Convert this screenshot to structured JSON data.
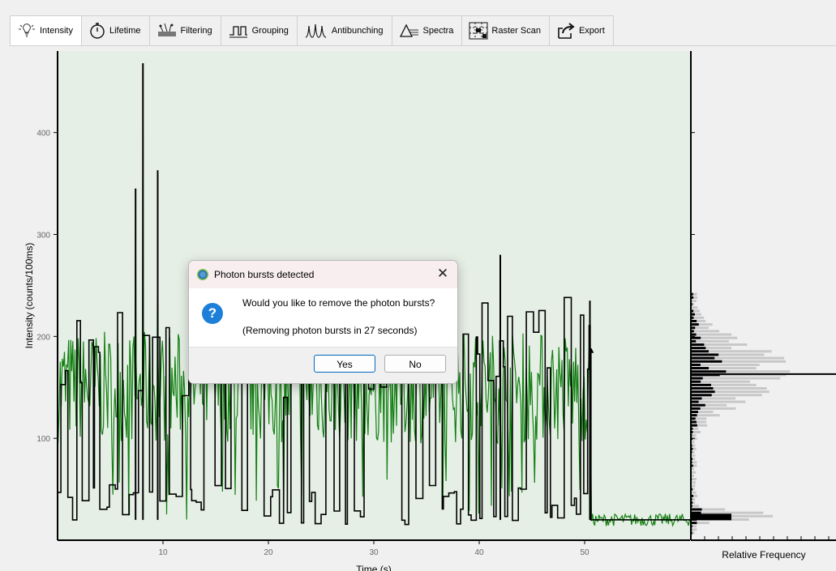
{
  "tabs": [
    {
      "label": "Intensity",
      "icon": "lightbulb-icon",
      "active": true
    },
    {
      "label": "Lifetime",
      "icon": "stopwatch-icon",
      "active": false
    },
    {
      "label": "Filtering",
      "icon": "filter-icon",
      "active": false
    },
    {
      "label": "Grouping",
      "icon": "grouping-icon",
      "active": false
    },
    {
      "label": "Antibunching",
      "icon": "antibunching-icon",
      "active": false
    },
    {
      "label": "Spectra",
      "icon": "prism-icon",
      "active": false
    },
    {
      "label": "Raster Scan",
      "icon": "raster-scan-icon",
      "active": false
    },
    {
      "label": "Export",
      "icon": "export-icon",
      "active": false
    }
  ],
  "dialog": {
    "title": "Photon bursts detected",
    "message": "Would you like to remove the photon bursts?",
    "countdown": "(Removing photon bursts in 27 seconds)",
    "yes_label": "Yes",
    "no_label": "No"
  },
  "colors": {
    "plot_bg": "#e6efe6",
    "trace": "#128012",
    "levels": "#000000",
    "hist_gray": "#c8c8c8",
    "hist_black": "#000000"
  },
  "chart_data": [
    {
      "type": "line",
      "xlabel": "Time (s)",
      "ylabel": "Intensity (counts/100ms)",
      "xlim": [
        0,
        60
      ],
      "ylim": [
        0,
        480
      ],
      "x_ticks": [
        10,
        20,
        30,
        40,
        50
      ],
      "y_ticks": [
        100,
        200,
        300,
        400
      ],
      "series": [
        {
          "description": "intensity trace",
          "color": "#128012"
        },
        {
          "description": "resolved levels",
          "color": "#000000"
        }
      ],
      "notable_points": [
        {
          "x": 8.1,
          "y": 468
        },
        {
          "x": 9.5,
          "y": 363
        },
        {
          "x": 7.4,
          "y": 345
        },
        {
          "x": 42.0,
          "y": 280
        },
        {
          "x": 50.5,
          "y": 235
        }
      ],
      "step_drop_at": 50.6,
      "low_level": 20
    },
    {
      "type": "bar",
      "orientation": "horizontal",
      "xlabel": "Relative Frequency",
      "shares_y_axis": true,
      "peak_intensity": 163,
      "secondary_peak_intensity": 22
    }
  ]
}
